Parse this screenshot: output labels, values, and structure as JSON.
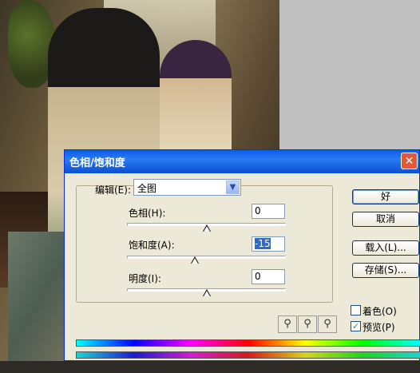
{
  "dialog": {
    "title": "色相/饱和度",
    "close_glyph": "✕",
    "edit_label": "编辑(E):",
    "edit_value": "全图",
    "hue_label": "色相(H):",
    "hue_value": "0",
    "hue_level": 0,
    "saturation_label": "饱和度(A):",
    "saturation_value": "-15",
    "saturation_level": -15,
    "lightness_label": "明度(I):",
    "lightness_value": "0",
    "lightness_level": 0
  },
  "buttons": {
    "ok": "好",
    "cancel": "取消",
    "load": "载入(L)...",
    "save": "存储(S)..."
  },
  "eyedroppers": [
    {
      "icon": "eyedropper-icon",
      "glyph": "⚲"
    },
    {
      "icon": "eyedropper-plus-icon",
      "glyph": "⚲"
    },
    {
      "icon": "eyedropper-minus-icon",
      "glyph": "⚲"
    }
  ],
  "options": {
    "colorize_label": "着色(O)",
    "colorize_checked": false,
    "preview_label": "预览(P)",
    "preview_checked": true,
    "check_glyph": "✓"
  },
  "colors": {
    "title_bar": "#0a5fe8",
    "dialog_bg": "#ece9d8"
  }
}
